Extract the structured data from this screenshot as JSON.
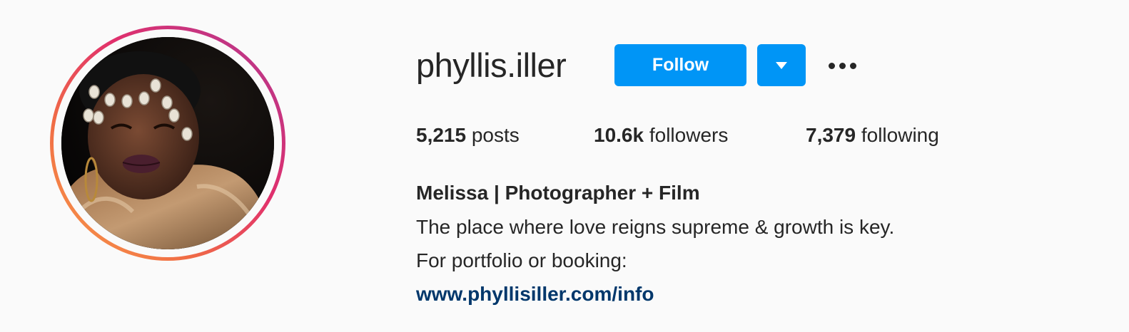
{
  "profile": {
    "username": "phyllis.iller",
    "avatar_icon": "profile-photo",
    "story_ring_colors": [
      "#f9a04a",
      "#e1306c",
      "#b72d9a"
    ]
  },
  "actions": {
    "follow_label": "Follow",
    "follow_color": "#0095f6",
    "dropdown_icon": "caret-down-icon",
    "more_icon": "more-options-icon"
  },
  "stats": {
    "posts_count": "5,215",
    "posts_label": "posts",
    "followers_count": "10.6k",
    "followers_label": "followers",
    "following_count": "7,379",
    "following_label": "following"
  },
  "bio": {
    "name": "Melissa | Photographer + Film",
    "line1": "The place where love reigns supreme & growth is key.",
    "line2": "For portfolio or booking:",
    "link": "www.phyllisiller.com/info",
    "link_color": "#00376b"
  }
}
